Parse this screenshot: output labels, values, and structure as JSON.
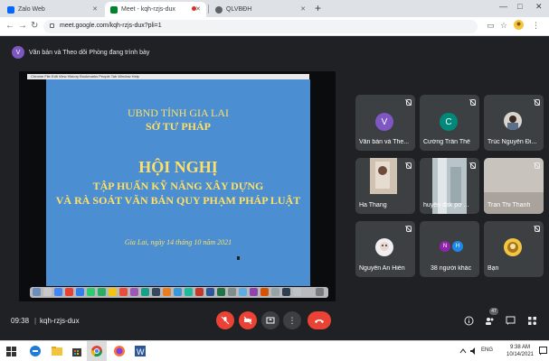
{
  "browser": {
    "tabs": [
      {
        "label": "Zalo Web",
        "favicon_color": "#0068ff"
      },
      {
        "label": "Meet - kqh-rzjs-dux",
        "favicon_color": "#00832d",
        "active": true
      },
      {
        "label": "QLVBĐH",
        "favicon_color": "#5f6368"
      }
    ],
    "url": "meet.google.com/kqh-rzjs-dux?pli=1",
    "new_tab": "+",
    "window_controls": [
      "—",
      "□",
      "✕"
    ]
  },
  "meet": {
    "presenter": {
      "initial": "V",
      "text": "Văn bản và Theo dõi Phòng đang trình bày"
    },
    "slide": {
      "menubar": "Chrome  File  Edit  View  History  Bookmarks  People  Tab  Window  Help",
      "line1": "UBND TỈNH GIA LAI",
      "line2": "SỞ TƯ PHÁP",
      "line3": "HỘI NGHỊ",
      "line4": "TẬP HUẤN KỸ NĂNG XÂY DỰNG",
      "line5": "VÀ RÀ SOÁT VĂN BẢN QUY PHẠM PHÁP LUẬT",
      "date": "Gia Lai, ngày 14 tháng 10 năm 2021"
    },
    "participants": [
      {
        "name": "Văn bản và The...",
        "initial": "V",
        "color": "#7e57c2",
        "kind": "avatar"
      },
      {
        "name": "Cường Trần Thế",
        "initial": "C",
        "color": "#00897b",
        "kind": "avatar"
      },
      {
        "name": "Trúc Nguyễn Đi...",
        "kind": "photo"
      },
      {
        "name": "Ha Thang",
        "kind": "video"
      },
      {
        "name": "huyện đak pơ ...",
        "kind": "video"
      },
      {
        "name": "Tran Thi Thanh",
        "kind": "video"
      },
      {
        "name": "Nguyễn An Hiền",
        "kind": "photo"
      },
      {
        "name": "38 người khác",
        "initials": [
          "N",
          "H"
        ],
        "colors": [
          "#8e24aa",
          "#1e88e5"
        ],
        "kind": "group"
      },
      {
        "name": "Bạn",
        "kind": "photo"
      }
    ],
    "bottom": {
      "time": "09:38",
      "separator": "|",
      "meeting_code": "kqh-rzjs-dux",
      "people_count": "47"
    }
  },
  "taskbar": {
    "language": "ENG",
    "clock_time": "9:38 AM",
    "clock_date": "10/14/2021"
  }
}
